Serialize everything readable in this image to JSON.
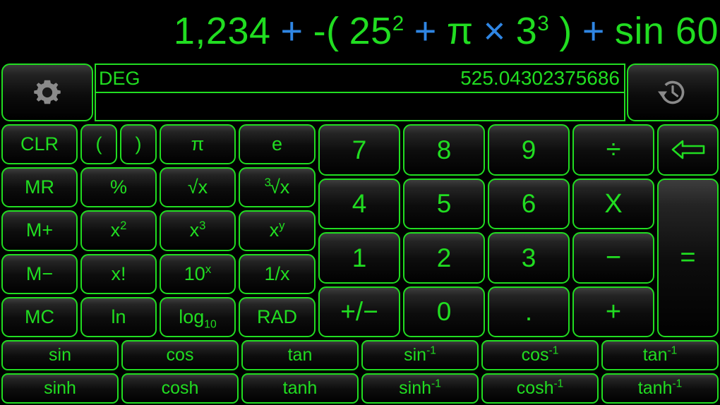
{
  "expression": {
    "display_text": "1,234 + -(25² + π × 3³) + sin 60",
    "tokens": [
      {
        "text": "1,234",
        "kind": "num"
      },
      {
        "text": "+",
        "kind": "op"
      },
      {
        "text": "-(",
        "kind": "num"
      },
      {
        "text": "25",
        "kind": "num",
        "sup": "2"
      },
      {
        "text": "+",
        "kind": "op"
      },
      {
        "text": "π",
        "kind": "num"
      },
      {
        "text": "×",
        "kind": "op"
      },
      {
        "text": "3",
        "kind": "num",
        "sup": "3"
      },
      {
        "text": ")",
        "kind": "num"
      },
      {
        "text": "+",
        "kind": "op"
      },
      {
        "text": "sin 60",
        "kind": "num"
      }
    ]
  },
  "display": {
    "angle_mode": "DEG",
    "result": "525.04302375686"
  },
  "toolbar": {
    "settings_icon": "gear-icon",
    "history_icon": "history-clock-icon"
  },
  "colors": {
    "green": "#21dd21",
    "blue": "#2f86e4",
    "background": "#000000",
    "icon_gray": "#8a8a8a"
  },
  "keypad": {
    "left_block": [
      {
        "label": "CLR",
        "name": "clear-button"
      },
      {
        "label": "(",
        "name": "open-paren-button"
      },
      {
        "label": ")",
        "name": "close-paren-button"
      },
      {
        "label": "π",
        "name": "pi-button"
      },
      {
        "label": "e",
        "name": "e-button"
      },
      {
        "label": "MR",
        "name": "memory-recall-button"
      },
      {
        "label": "%",
        "name": "percent-button"
      },
      {
        "label": "√x",
        "name": "square-root-button"
      },
      {
        "label": "√x",
        "name": "cube-root-button",
        "pre": "3"
      },
      {
        "label": "",
        "name": "spacer",
        "hidden": true
      },
      {
        "label": "M+",
        "name": "memory-add-button"
      },
      {
        "label": "x",
        "name": "x-squared-button",
        "sup": "2"
      },
      {
        "label": "x",
        "name": "x-cubed-button",
        "sup": "3"
      },
      {
        "label": "x",
        "name": "x-power-y-button",
        "sup": "y"
      },
      {
        "label": "",
        "name": "spacer",
        "hidden": true
      },
      {
        "label": "M−",
        "name": "memory-subtract-button"
      },
      {
        "label": "x!",
        "name": "factorial-button"
      },
      {
        "label": "10",
        "name": "ten-power-x-button",
        "sup": "x"
      },
      {
        "label": "1/x",
        "name": "reciprocal-button"
      },
      {
        "label": "",
        "name": "spacer",
        "hidden": true
      },
      {
        "label": "MC",
        "name": "memory-clear-button"
      },
      {
        "label": "ln",
        "name": "natural-log-button"
      },
      {
        "label": "log",
        "name": "log10-button",
        "sub": "10"
      },
      {
        "label": "RAD",
        "name": "rad-mode-button"
      },
      {
        "label": "",
        "name": "spacer",
        "hidden": true
      }
    ],
    "num_block": [
      {
        "label": "7",
        "name": "digit-7-button",
        "style": "num"
      },
      {
        "label": "8",
        "name": "digit-8-button",
        "style": "num"
      },
      {
        "label": "9",
        "name": "digit-9-button",
        "style": "num"
      },
      {
        "label": "÷",
        "name": "divide-button",
        "style": "op"
      },
      {
        "label": "⇦",
        "name": "backspace-button",
        "style": "icon-backspace"
      },
      {
        "label": "4",
        "name": "digit-4-button",
        "style": "num"
      },
      {
        "label": "5",
        "name": "digit-5-button",
        "style": "num"
      },
      {
        "label": "6",
        "name": "digit-6-button",
        "style": "num"
      },
      {
        "label": "X",
        "name": "multiply-button",
        "style": "op"
      },
      {
        "label": "=",
        "name": "equals-button",
        "style": "eq"
      },
      {
        "label": "1",
        "name": "digit-1-button",
        "style": "num"
      },
      {
        "label": "2",
        "name": "digit-2-button",
        "style": "num"
      },
      {
        "label": "3",
        "name": "digit-3-button",
        "style": "num"
      },
      {
        "label": "−",
        "name": "subtract-button",
        "style": "op"
      },
      {
        "label": "+/−",
        "name": "sign-toggle-button",
        "style": "num"
      },
      {
        "label": "0",
        "name": "digit-0-button",
        "style": "num"
      },
      {
        "label": ".",
        "name": "decimal-point-button",
        "style": "num"
      },
      {
        "label": "+",
        "name": "add-button",
        "style": "op"
      }
    ],
    "trig_block": [
      {
        "label": "sin",
        "name": "sin-button"
      },
      {
        "label": "cos",
        "name": "cos-button"
      },
      {
        "label": "tan",
        "name": "tan-button"
      },
      {
        "label": "sin",
        "name": "asin-button",
        "sup": "-1"
      },
      {
        "label": "cos",
        "name": "acos-button",
        "sup": "-1"
      },
      {
        "label": "tan",
        "name": "atan-button",
        "sup": "-1"
      },
      {
        "label": "sinh",
        "name": "sinh-button"
      },
      {
        "label": "cosh",
        "name": "cosh-button"
      },
      {
        "label": "tanh",
        "name": "tanh-button"
      },
      {
        "label": "sinh",
        "name": "asinh-button",
        "sup": "-1"
      },
      {
        "label": "cosh",
        "name": "acosh-button",
        "sup": "-1"
      },
      {
        "label": "tanh",
        "name": "atanh-button",
        "sup": "-1"
      }
    ]
  }
}
